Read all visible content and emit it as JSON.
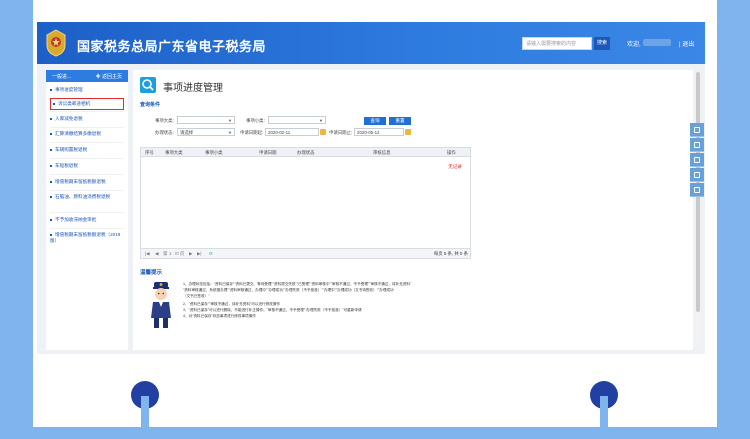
{
  "header": {
    "title": "国家税务总局广东省电子税务局",
    "search_placeholder": "请输入需要搜索的内容",
    "search_button": "搜索",
    "welcome": "欢迎,",
    "logout": "| 退出"
  },
  "sidebar": {
    "head_left": "一般进...",
    "head_right": "✚ 返回主页",
    "items": [
      {
        "label": "事项进度管理"
      },
      {
        "label": "诉讼类邮递相机"
      },
      {
        "label": "入库减免退税"
      },
      {
        "label": "汇算清缴结算多缴退税"
      },
      {
        "label": "车辆购置税退税"
      },
      {
        "label": "车船税退税"
      },
      {
        "label": "增值税期末留抵税额退税"
      },
      {
        "label": "石脑油、燃料油消费税退税"
      },
      {
        "label": "不予加收滞纳金审批"
      },
      {
        "label": "增值税期末留抵税额退税（2019版）"
      }
    ]
  },
  "page": {
    "title": "事项进度管理",
    "conditions_title": "查询条件",
    "filters": {
      "category_label": "事项大类:",
      "subcategory_label": "事项小类:",
      "status_label": "办理状态:",
      "status_value": "请选择",
      "start_label": "申请日期起:",
      "start_value": "2020-02-11",
      "end_label": "申请日期止:",
      "end_value": "2020-05-12"
    },
    "buttons": {
      "query": "查询",
      "reset": "重置"
    }
  },
  "table": {
    "columns": [
      "序号",
      "事项大类",
      "事项小类",
      "申请日期",
      "办理状态",
      "审核信息",
      "操作"
    ],
    "empty_text": "无记录",
    "pager": {
      "first": "|◀",
      "prev": "◀",
      "page_label": "第",
      "page_value": "1",
      "of_pages": "/0 页",
      "next": "▶",
      "last": "▶|",
      "refresh": "⟳",
      "per_page": "每页 5 条, 共 0 条"
    }
  },
  "tips": {
    "title": "温馨提示",
    "lines": [
      "1、办理状态包括：\"资料已保存\"\"资料已提交、等待受理\"\"资料提交失败\"\"已受理\"\"资料审核中\"\"审核不通过，不予受理\"\"审核不通过，待补充资料\"",
      "\"资料审核通过，系统推办理\"\"资料审核通过，办理中\"\"办理成功\"\"办理失败（不予批准）\"\"办理中\"\"办理成功（文书待签收）\"\"办理成功",
      "（文书已签收）\"",
      "2、\"资料已保存\"\"审核不通过，待补充资料\"可以进行修改操作",
      "3、\"资料已保存\"可以进行删除，不能进行补正操作；\"审核不通过，不予受理\"\"办理失败（不予批准）\"可重新申请",
      "4、对\"资料已保存\"状态事项进行修改事项操作"
    ]
  },
  "colors": {
    "brand_blue": "#2f7ce0",
    "link_blue": "#1b58b8",
    "alert_red": "#e12d2d",
    "page_background": "#7fb5ef"
  }
}
